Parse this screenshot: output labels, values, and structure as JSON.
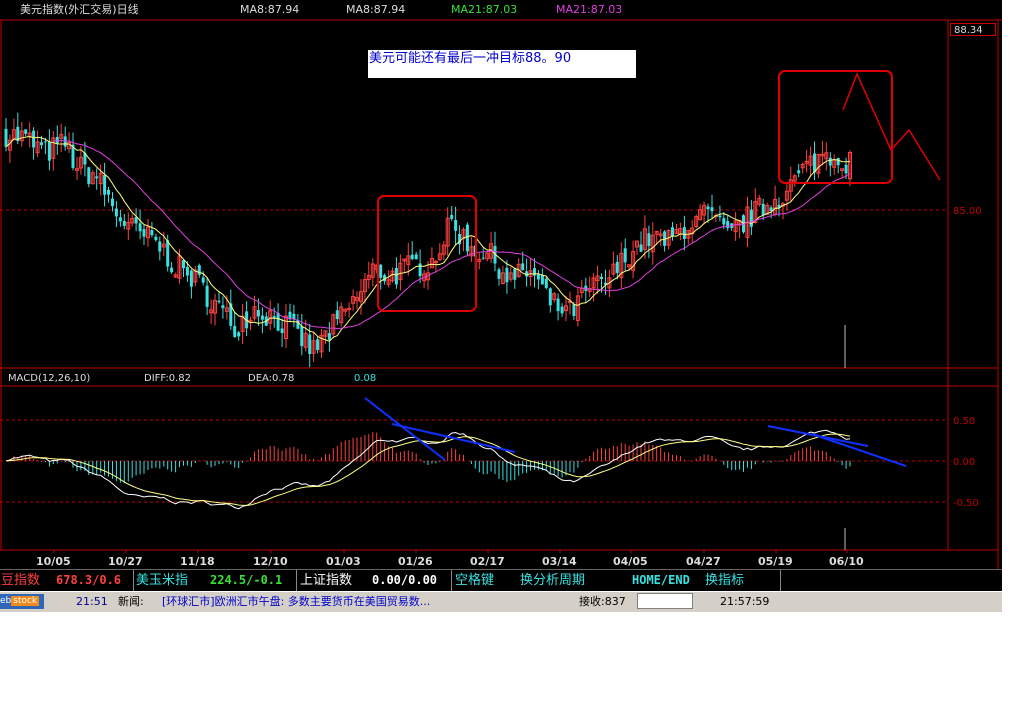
{
  "header": {
    "title": "美元指数(外汇交易)日线",
    "ma8_a": "MA8:87.94",
    "ma8_b": "MA8:87.94",
    "ma21_a": "MA21:87.03",
    "ma21_b": "MA21:87.03"
  },
  "price_box": "88.34",
  "annotation_note": "美元可能还有最后一冲目标88。90",
  "macd_header": {
    "label": "MACD(12,26,10)",
    "diff": "DIFF:0.82",
    "dea": "DEA:0.78",
    "macd": "0.08"
  },
  "colors": {
    "up": "#ff4040",
    "down": "#38e0e0",
    "ma8": "#ffff80",
    "ma21": "#e040e0",
    "grid": "#c00000",
    "annotation": "#e00000",
    "trendline": "#1030ff"
  },
  "bottom_ticker": [
    {
      "name": "豆指数",
      "value": "678.3/0.6",
      "name_color": "#ff4040",
      "value_color": "#ff4040"
    },
    {
      "name": "美玉米指",
      "value": "224.5/-0.1",
      "name_color": "#38e0e0",
      "value_color": "#38e038"
    },
    {
      "name": "上证指数",
      "value": "0.00/0.00",
      "name_color": "#ffffff",
      "value_color": "#ffffff"
    },
    {
      "name": "空格键",
      "value": "换分析周期",
      "name_color": "#38e0e0",
      "value_color": "#38e0e0"
    },
    {
      "name": "HOME/END",
      "value": "换指标",
      "name_color": "#38e0e0",
      "value_color": "#38e0e0"
    }
  ],
  "status_bar": {
    "logo": "eb",
    "logo2": "stock",
    "news_time": "21:51",
    "news_label": "新闻:",
    "news_text": "[环球汇市]欧洲汇市午盘: 多数主要货币在美国贸易数...",
    "recv_label": "接收:837",
    "clock": "21:57:59"
  },
  "chart_data": [
    {
      "type": "candlestick",
      "title": "美元指数(外汇交易)日线",
      "x_tick_labels": [
        "10/05",
        "10/27",
        "11/18",
        "12/10",
        "01/03",
        "01/26",
        "02/17",
        "03/14",
        "04/05",
        "04/27",
        "05/19",
        "06/10"
      ],
      "y_tick_labels": [
        "85.00"
      ],
      "last_price": 88.34,
      "ma": [
        {
          "name": "MA8",
          "value": 87.94
        },
        {
          "name": "MA21",
          "value": 87.03
        }
      ],
      "approx_close_path": [
        [
          0,
          87.1
        ],
        [
          5,
          87.0
        ],
        [
          10,
          86.7
        ],
        [
          15,
          86.9
        ],
        [
          18,
          86.4
        ],
        [
          23,
          86.2
        ],
        [
          28,
          85.4
        ],
        [
          33,
          85.0
        ],
        [
          38,
          84.8
        ],
        [
          43,
          84.3
        ],
        [
          48,
          84.0
        ],
        [
          53,
          83.5
        ],
        [
          58,
          83.0
        ],
        [
          63,
          83.4
        ],
        [
          68,
          83.2
        ],
        [
          73,
          82.9
        ],
        [
          78,
          82.5
        ],
        [
          83,
          83.0
        ],
        [
          88,
          83.5
        ],
        [
          93,
          84.2
        ],
        [
          98,
          84.1
        ],
        [
          103,
          84.3
        ],
        [
          108,
          84.4
        ],
        [
          113,
          85.2
        ],
        [
          118,
          84.7
        ],
        [
          123,
          84.5
        ],
        [
          128,
          84.0
        ],
        [
          133,
          84.2
        ],
        [
          138,
          83.5
        ],
        [
          143,
          83.3
        ],
        [
          148,
          83.8
        ],
        [
          153,
          84.0
        ],
        [
          158,
          84.6
        ],
        [
          163,
          84.9
        ],
        [
          168,
          84.8
        ],
        [
          173,
          85.2
        ],
        [
          178,
          85.4
        ],
        [
          183,
          84.9
        ],
        [
          188,
          85.3
        ],
        [
          193,
          85.6
        ],
        [
          198,
          85.9
        ],
        [
          203,
          86.4
        ],
        [
          208,
          86.7
        ],
        [
          214,
          86.5
        ]
      ],
      "annotations": [
        {
          "type": "box",
          "label": "rally box 1"
        },
        {
          "type": "box",
          "label": "rally box 2"
        },
        {
          "type": "projection",
          "label": "target zigzag"
        }
      ]
    },
    {
      "type": "macd",
      "title": "MACD(12,26,10)",
      "y_tick_labels": [
        "0.50",
        "0.00",
        "-0.50"
      ],
      "ylim": [
        -1.05,
        0.85
      ],
      "diff": 0.82,
      "dea": 0.78,
      "macd": 0.08
    }
  ]
}
